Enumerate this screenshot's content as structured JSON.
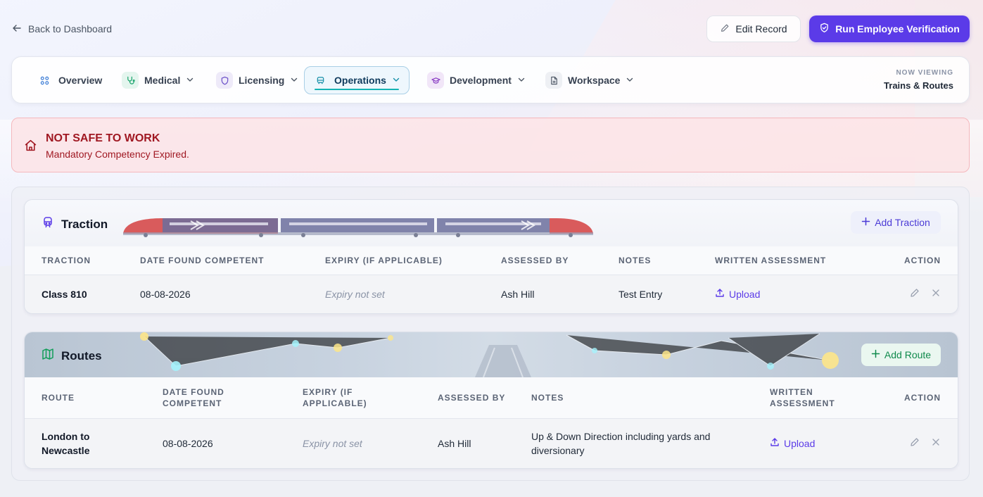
{
  "topbar": {
    "back_label": "Back to Dashboard",
    "edit_label": "Edit Record",
    "verify_label": "Run Employee Verification"
  },
  "nav": {
    "items": [
      {
        "label": "Overview",
        "icon": "grid-icon"
      },
      {
        "label": "Medical",
        "icon": "stethoscope-icon"
      },
      {
        "label": "Licensing",
        "icon": "shield-icon"
      },
      {
        "label": "Operations",
        "icon": "train-icon"
      },
      {
        "label": "Development",
        "icon": "graduation-cap-icon"
      },
      {
        "label": "Workspace",
        "icon": "document-icon"
      }
    ],
    "active": "Operations",
    "now_viewing_label": "NOW VIEWING",
    "now_viewing_value": "Trains & Routes"
  },
  "alert": {
    "title": "NOT SAFE TO WORK",
    "message": "Mandatory Competency Expired."
  },
  "traction": {
    "title": "Traction",
    "add_label": "Add Traction",
    "columns": [
      "TRACTION",
      "DATE FOUND COMPETENT",
      "EXPIRY (IF APPLICABLE)",
      "ASSESSED BY",
      "NOTES",
      "WRITTEN ASSESSMENT",
      "ACTION"
    ],
    "rows": [
      {
        "traction": "Class 810",
        "date": "08-08-2026",
        "expiry": "Expiry not set",
        "assessed_by": "Ash Hill",
        "notes": "Test Entry",
        "upload": "Upload"
      }
    ]
  },
  "routes": {
    "title": "Routes",
    "add_label": "Add Route",
    "columns": [
      "ROUTE",
      "DATE FOUND COMPETENT",
      "EXPIRY (IF APPLICABLE)",
      "ASSESSED BY",
      "NOTES",
      "WRITTEN ASSESSMENT",
      "ACTION"
    ],
    "rows": [
      {
        "route": "London to Newcastle",
        "date": "08-08-2026",
        "expiry": "Expiry not set",
        "assessed_by": "Ash Hill",
        "notes": "Up & Down Direction including yards and diversionary",
        "upload": "Upload"
      }
    ]
  },
  "colors": {
    "primary": "#5b3be8",
    "danger": "#a01822",
    "accent_teal": "#14b3b3",
    "success": "#0f9d58"
  }
}
